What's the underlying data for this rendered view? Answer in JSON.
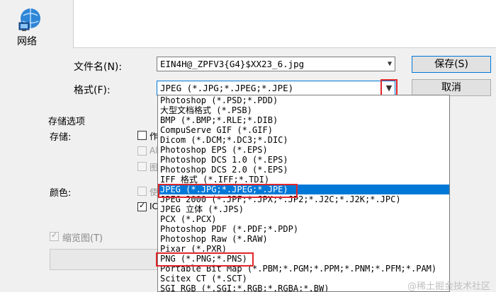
{
  "sidebar": {
    "network_label": "网络",
    "network_icon": "network-computer-icon"
  },
  "form": {
    "filename_label": "文件名(N):",
    "filename_value": "EIN4H@_ZPFV3{G4}$XX23_6.jpg",
    "format_label": "格式(F):",
    "format_value": "JPEG (*.JPG;*.JPEG;*.JPE)"
  },
  "buttons": {
    "save": "保存(S)",
    "cancel": "取消"
  },
  "options": {
    "group_title": "存储选项",
    "storage_label": "存储:",
    "storage_check_1": "作",
    "storage_check_2": "Al",
    "storage_check_3": "图",
    "color_label": "颜色:",
    "color_check_1": "使",
    "color_check_2": "IC",
    "thumbnail_label": "缩览图(T)"
  },
  "format_options": [
    "Photoshop (*.PSD;*.PDD)",
    "大型文档格式 (*.PSB)",
    "BMP (*.BMP;*.RLE;*.DIB)",
    "CompuServe GIF (*.GIF)",
    "Dicom (*.DCM;*.DC3;*.DIC)",
    "Photoshop EPS (*.EPS)",
    "Photoshop DCS 1.0 (*.EPS)",
    "Photoshop DCS 2.0 (*.EPS)",
    "IFF 格式 (*.IFF;*.TDI)",
    "JPEG (*.JPG;*.JPEG;*.JPE)",
    "JPEG 2000 (*.JPF;*.JPX;*.JP2;*.J2C;*.J2K;*.JPC)",
    "JPEG 立体 (*.JPS)",
    "PCX (*.PCX)",
    "Photoshop PDF (*.PDF;*.PDP)",
    "Photoshop Raw (*.RAW)",
    "Pixar (*.PXR)",
    "PNG (*.PNG;*.PNS)",
    "Portable Bit Map (*.PBM;*.PGM;*.PPM;*.PNM;*.PFM;*.PAM)",
    "Scitex CT (*.SCT)",
    "SGI RGB (*.SGI;*.RGB;*.RGBA;*.BW)"
  ],
  "selected_index": 9,
  "watermark": "@稀土掘金技术社区",
  "colors": {
    "selection": "#0078d7",
    "highlight_box": "#e0262a"
  }
}
